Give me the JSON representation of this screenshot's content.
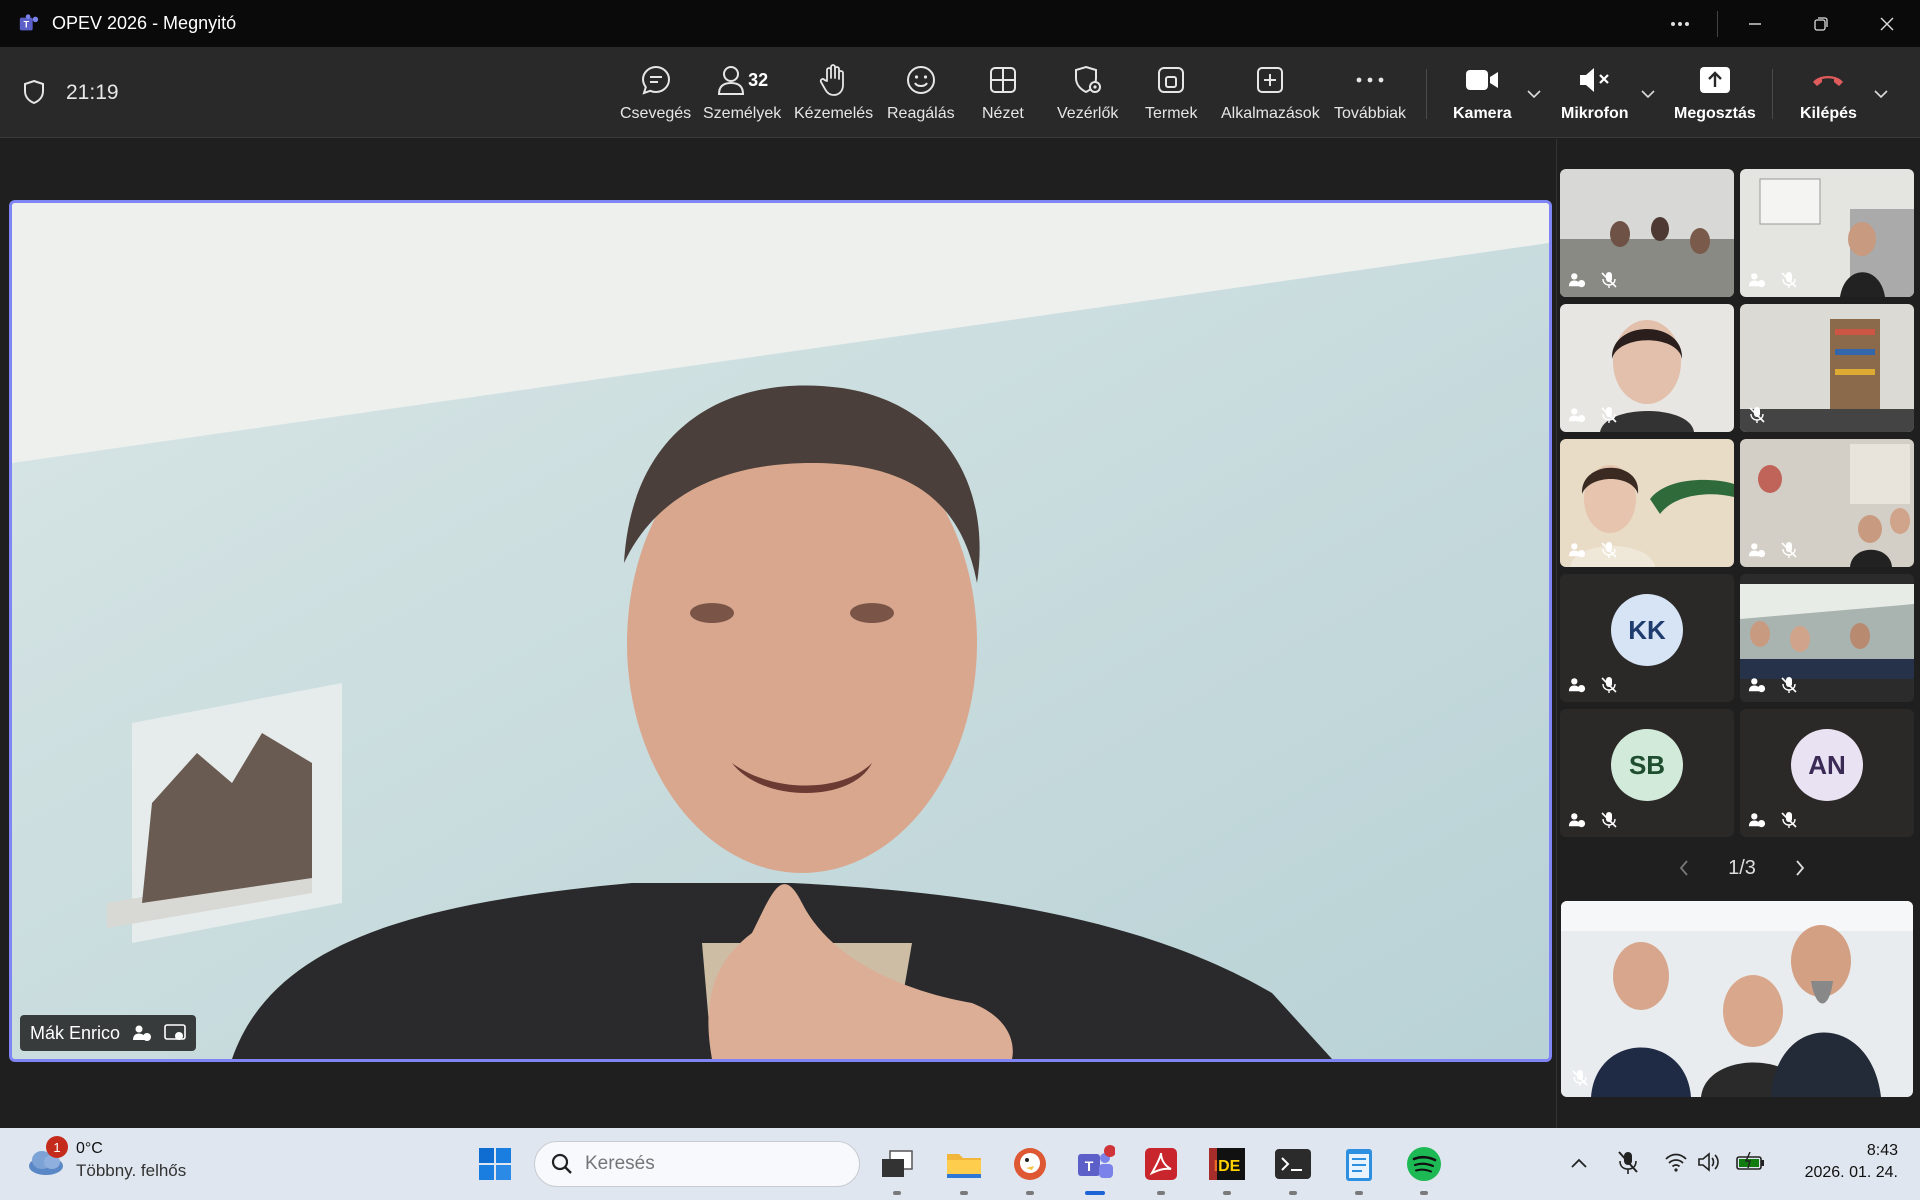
{
  "window": {
    "title": "OPEV 2026 - Megnyitó"
  },
  "meeting": {
    "elapsed": "21:19",
    "participants_count": "32",
    "toolbar": {
      "chat": "Csevegés",
      "people": "Személyek",
      "raise": "Kézemelés",
      "react": "Reagálás",
      "view": "Nézet",
      "controls": "Vezérlők",
      "rooms": "Termek",
      "apps": "Alkalmazások",
      "more": "Továbbiak",
      "camera": "Kamera",
      "mic": "Mikrofon",
      "share": "Megosztás",
      "leave": "Kilépés"
    },
    "colors": {
      "accent": "#7f85f5",
      "leave": "#e05b5b"
    }
  },
  "main_speaker": {
    "name": "Mák Enrico"
  },
  "gallery": {
    "page": "1/3",
    "avatars": [
      {
        "initials": "KK",
        "bg": "#d6e4f5",
        "fg": "#1f3c6e"
      },
      {
        "initials": "SB",
        "bg": "#d2ead9",
        "fg": "#1e4d2f"
      },
      {
        "initials": "AN",
        "bg": "#e9e2f2",
        "fg": "#3a2a55"
      }
    ]
  },
  "taskbar": {
    "weather_temp": "0°C",
    "weather_desc": "Többny. felhős",
    "weather_badge": "1",
    "search_placeholder": "Keresés",
    "time": "8:43",
    "date": "2026. 01. 24."
  }
}
